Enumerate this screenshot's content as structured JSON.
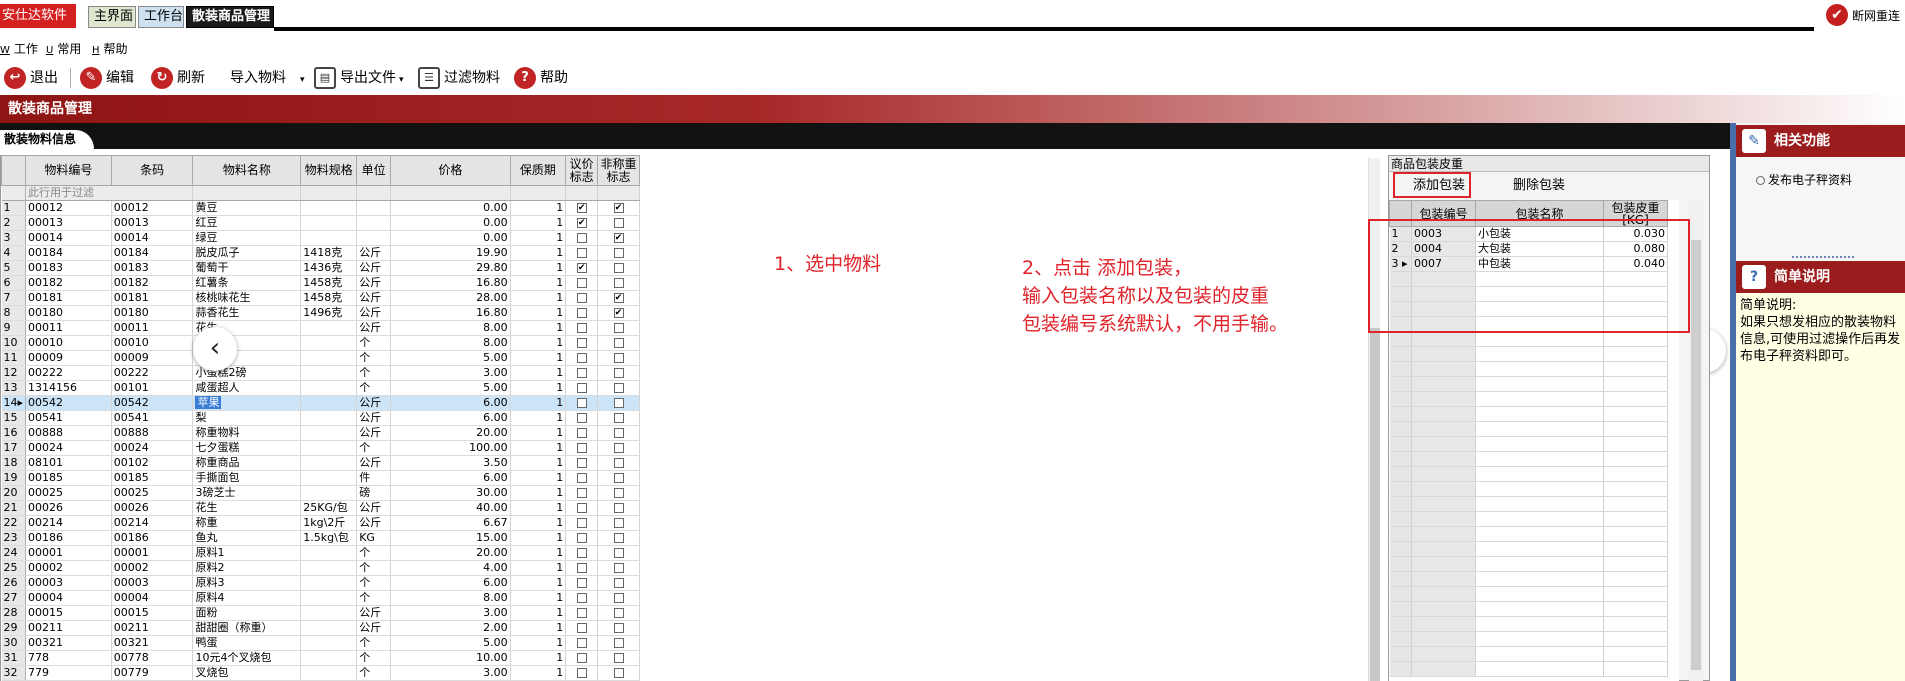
{
  "titlebar": {
    "brand": "安仕达软件",
    "tabs": [
      "主界面",
      "工作台",
      "散装商品管理"
    ],
    "offline_label": "断网重连"
  },
  "menu": [
    {
      "key": "W",
      "label": "工作"
    },
    {
      "key": "U",
      "label": "常用"
    },
    {
      "key": "H",
      "label": "帮助"
    }
  ],
  "toolbar": {
    "exit": "退出",
    "edit": "编辑",
    "refresh": "刷新",
    "import": "导入物料",
    "export": "导出文件",
    "filter": "过滤物料",
    "help": "帮助"
  },
  "section_title": "散装商品管理",
  "info_tab": "散装物料信息",
  "grid": {
    "headers": [
      "物料编号",
      "条码",
      "物料名称",
      "物料规格",
      "单位",
      "价格",
      "保质期",
      "议价标志",
      "非称重标志"
    ],
    "filter_hint": "此行用于过滤",
    "rows": [
      [
        "1",
        "00012",
        "00012",
        "黄豆",
        "",
        "",
        "0.00",
        "1",
        "✔",
        "✔"
      ],
      [
        "2",
        "00013",
        "00013",
        "红豆",
        "",
        "",
        "0.00",
        "1",
        "✔",
        ""
      ],
      [
        "3",
        "00014",
        "00014",
        "绿豆",
        "",
        "",
        "0.00",
        "1",
        "",
        "✔"
      ],
      [
        "4",
        "00184",
        "00184",
        "脱皮瓜子",
        "1418克",
        "公斤",
        "19.90",
        "1",
        "",
        ""
      ],
      [
        "5",
        "00183",
        "00183",
        "葡萄干",
        "1436克",
        "公斤",
        "29.80",
        "1",
        "✔",
        ""
      ],
      [
        "6",
        "00182",
        "00182",
        "红薯条",
        "1458克",
        "公斤",
        "16.80",
        "1",
        "",
        ""
      ],
      [
        "7",
        "00181",
        "00181",
        "核桃味花生",
        "1458克",
        "公斤",
        "28.00",
        "1",
        "",
        "✔"
      ],
      [
        "8",
        "00180",
        "00180",
        "蒜香花生",
        "1496克",
        "公斤",
        "16.80",
        "1",
        "",
        "✔"
      ],
      [
        "9",
        "00011",
        "00011",
        "花生",
        "",
        "公斤",
        "8.00",
        "1",
        "",
        ""
      ],
      [
        "10",
        "00010",
        "00010",
        "",
        "",
        "个",
        "8.00",
        "1",
        "",
        ""
      ],
      [
        "11",
        "00009",
        "00009",
        "",
        "",
        "个",
        "5.00",
        "1",
        "",
        ""
      ],
      [
        "12",
        "00222",
        "00222",
        "小蛋糕2磅",
        "",
        "个",
        "3.00",
        "1",
        "",
        ""
      ],
      [
        "13",
        "1314156",
        "00101",
        "咸蛋超人",
        "",
        "个",
        "5.00",
        "1",
        "",
        ""
      ],
      [
        "14",
        "00542",
        "00542",
        "苹果",
        "",
        "公斤",
        "6.00",
        "1",
        "",
        ""
      ],
      [
        "15",
        "00541",
        "00541",
        "梨",
        "",
        "公斤",
        "6.00",
        "1",
        "",
        ""
      ],
      [
        "16",
        "00888",
        "00888",
        "称重物料",
        "",
        "公斤",
        "20.00",
        "1",
        "",
        ""
      ],
      [
        "17",
        "00024",
        "00024",
        "七夕蛋糕",
        "",
        "个",
        "100.00",
        "1",
        "",
        ""
      ],
      [
        "18",
        "08101",
        "00102",
        "称重商品",
        "",
        "公斤",
        "3.50",
        "1",
        "",
        ""
      ],
      [
        "19",
        "00185",
        "00185",
        "手撕面包",
        "",
        "件",
        "6.00",
        "1",
        "",
        ""
      ],
      [
        "20",
        "00025",
        "00025",
        "3磅芝士",
        "",
        "磅",
        "30.00",
        "1",
        "",
        ""
      ],
      [
        "21",
        "00026",
        "00026",
        "花生",
        "25KG/包",
        "公斤",
        "40.00",
        "1",
        "",
        ""
      ],
      [
        "22",
        "00214",
        "00214",
        "称重",
        "1kg\\2斤",
        "公斤",
        "6.67",
        "1",
        "",
        ""
      ],
      [
        "23",
        "00186",
        "00186",
        "鱼丸",
        "1.5kg\\包",
        "KG",
        "15.00",
        "1",
        "",
        ""
      ],
      [
        "24",
        "00001",
        "00001",
        "原料1",
        "",
        "个",
        "20.00",
        "1",
        "",
        ""
      ],
      [
        "25",
        "00002",
        "00002",
        "原料2",
        "",
        "个",
        "4.00",
        "1",
        "",
        ""
      ],
      [
        "26",
        "00003",
        "00003",
        "原料3",
        "",
        "个",
        "6.00",
        "1",
        "",
        ""
      ],
      [
        "27",
        "00004",
        "00004",
        "原料4",
        "",
        "个",
        "8.00",
        "1",
        "",
        ""
      ],
      [
        "28",
        "00015",
        "00015",
        "面粉",
        "",
        "公斤",
        "3.00",
        "1",
        "",
        ""
      ],
      [
        "29",
        "00211",
        "00211",
        "甜甜圈（称重）",
        "",
        "公斤",
        "2.00",
        "1",
        "",
        ""
      ],
      [
        "30",
        "00321",
        "00321",
        "鸭蛋",
        "",
        "个",
        "5.00",
        "1",
        "",
        ""
      ],
      [
        "31",
        "778",
        "00778",
        "10元4个叉烧包",
        "",
        "个",
        "10.00",
        "1",
        "",
        ""
      ],
      [
        "32",
        "779",
        "00779",
        "叉烧包",
        "",
        "个",
        "3.00",
        "1",
        "",
        ""
      ]
    ]
  },
  "annotations": {
    "step1": "1、选中物料",
    "step2_line1": "2、点击 添加包装，",
    "step2_line2": "输入包装名称以及包装的皮重",
    "step2_line3": "包装编号系统默认，不用手输。"
  },
  "packaging": {
    "title": "商品包装皮重",
    "add_button": "添加包装",
    "delete_button": "删除包装",
    "headers": [
      "包装编号",
      "包装名称",
      "包装皮重[KG]"
    ],
    "rows": [
      [
        "1",
        "0003",
        "小包装",
        "0.030"
      ],
      [
        "2",
        "0004",
        "大包装",
        "0.080"
      ],
      [
        "3",
        "0007",
        "中包装",
        "0.040"
      ]
    ]
  },
  "side": {
    "related_title": "相关功能",
    "publish_link": "发布电子秤资料",
    "guide_title": "简单说明",
    "guide_text": "简单说明:\n如果只想发相应的散装物料信息,可使用过滤操作后再发布电子秤资料即可。"
  },
  "icons": {
    "exit": "exit-icon",
    "edit": "pencil-icon",
    "refresh": "refresh-icon",
    "export": "document-icon",
    "filter": "list-icon",
    "help": "question-icon",
    "offline": "check-icon",
    "nav_prev": "chevron-left-icon",
    "nav_next": "chevron-right-icon"
  },
  "colors": {
    "brand_red": "#d42020",
    "section_red": "#8f1414",
    "annotation_red": "#e0232a",
    "selection_blue": "#cce4f7"
  }
}
